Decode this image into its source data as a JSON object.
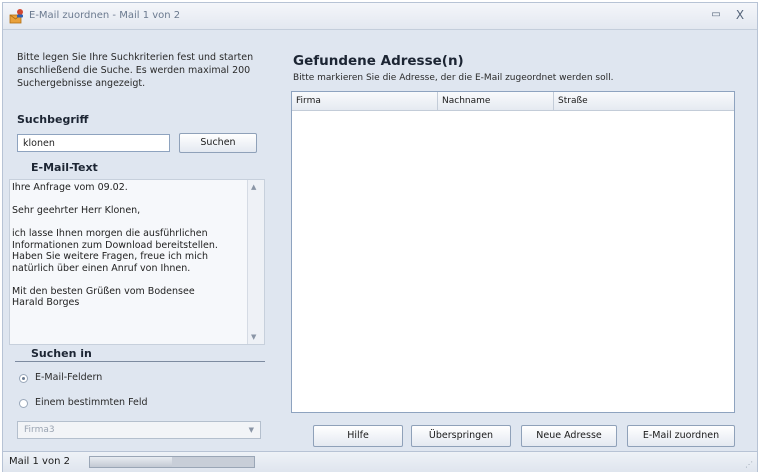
{
  "window": {
    "title": "E-Mail zuordnen - Mail 1 von 2",
    "minimize_glyph": "▭",
    "close_glyph": "X"
  },
  "left": {
    "intro": "Bitte legen Sie Ihre Suchkriterien fest und starten anschließend die Suche. Es werden maximal 200 Suchergebnisse angezeigt.",
    "search_label": "Suchbegriff",
    "search_value": "klonen",
    "search_button": "Suchen",
    "mail_label": "E-Mail-Text",
    "mail_text": "Ihre Anfrage vom 09.02.\n\nSehr geehrter Herr Klonen,\n\nich lasse Ihnen morgen die ausführlichen\nInformationen zum Download bereitstellen.\nHaben Sie weitere Fragen, freue ich mich\nnatürlich über einen Anruf von Ihnen.\n\nMit den besten Grüßen vom Bodensee\nHarald Borges",
    "search_in_label": "Suchen in",
    "radio_options": [
      "E-Mail-Feldern",
      "Einem bestimmten Feld"
    ],
    "radio_selected": "E-Mail-Feldern",
    "field_select_value": "Firma3"
  },
  "right": {
    "title": "Gefundene Adresse(n)",
    "hint": "Bitte markieren Sie die Adresse, der die E-Mail zugeordnet werden soll.",
    "columns": [
      "Firma",
      "Nachname",
      "Straße"
    ],
    "rows": []
  },
  "buttons": {
    "help": "Hilfe",
    "skip": "Überspringen",
    "new_address": "Neue Adresse",
    "assign": "E-Mail zuordnen"
  },
  "status": {
    "text": "Mail 1 von 2",
    "progress_fraction": 0.5
  },
  "colors": {
    "window_bg": "#dfe6f0",
    "accent": "#8ea3bf"
  },
  "icons": {
    "app": "mail-contact-icon",
    "minimize": "minimize-icon",
    "close": "close-icon"
  }
}
